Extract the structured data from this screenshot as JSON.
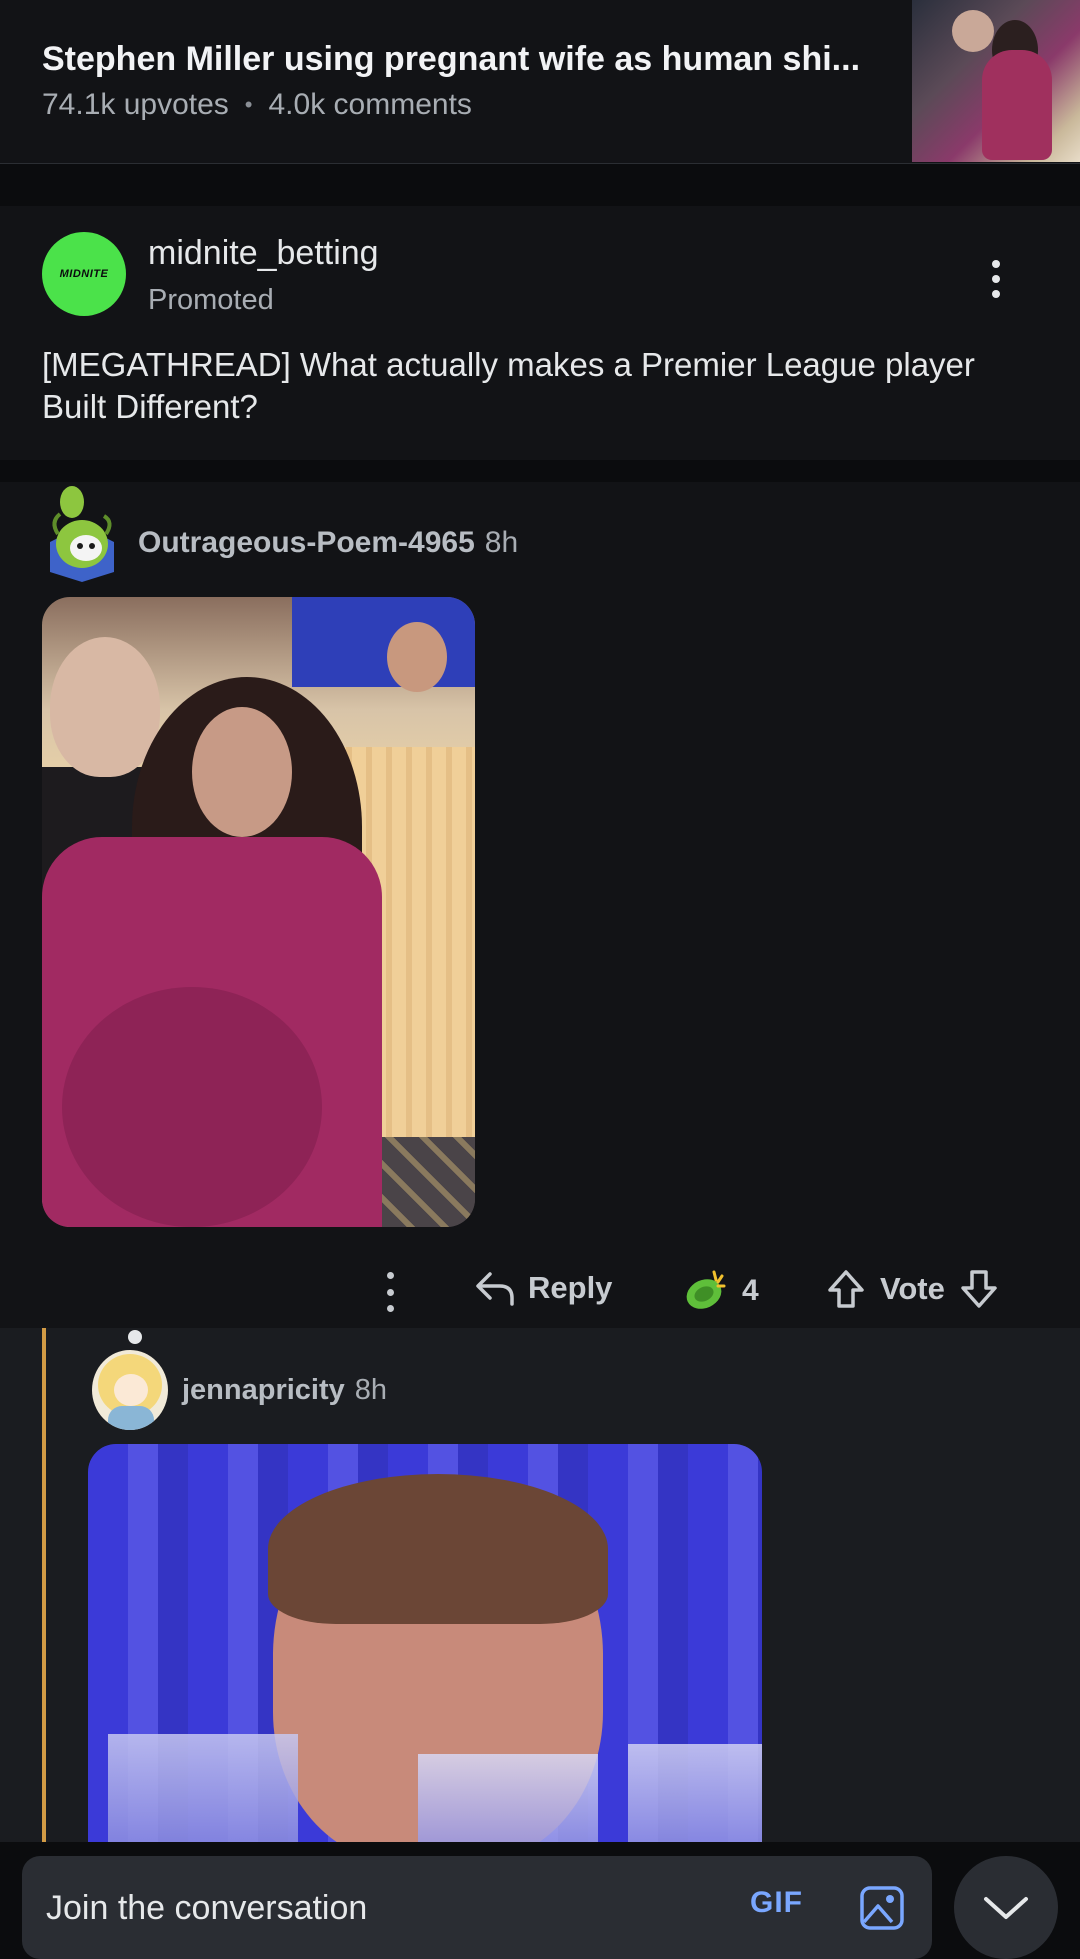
{
  "post": {
    "title": "Stephen Miller using pregnant wife as human shi...",
    "upvotes": "74.1k upvotes",
    "separator": "•",
    "comments": "4.0k comments"
  },
  "ad": {
    "advertiser": "midnite_betting",
    "avatar_text": "MIDNITE",
    "promoted_label": "Promoted",
    "title": "[MEGATHREAD] What actually makes a Premier League player Built Different?"
  },
  "comment1": {
    "author": "Outrageous-Poem-4965",
    "age": "8h",
    "actions": {
      "reply_label": "Reply",
      "award_count": "4",
      "vote_label": "Vote"
    }
  },
  "comment2": {
    "author": "jennapricity",
    "age": "8h"
  },
  "compose": {
    "placeholder": "Join the conversation",
    "gif_label": "GIF"
  },
  "colors": {
    "background": "#0b0c0e",
    "card": "#121316",
    "reply_card": "#1a1c20",
    "thread_bar": "#d29b45",
    "advertiser_green": "#4be24a",
    "gif_blue": "#7aa7ff"
  }
}
